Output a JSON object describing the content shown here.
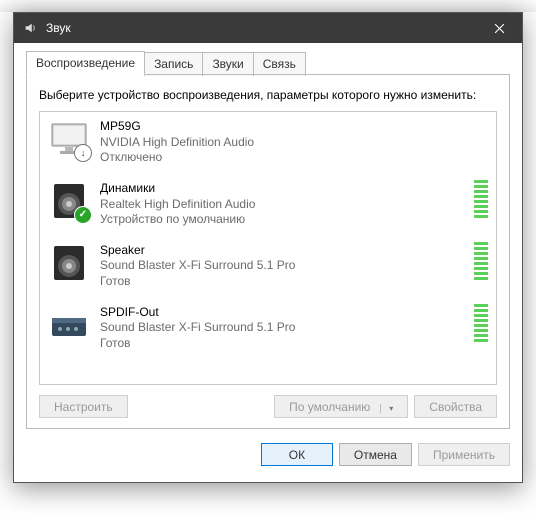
{
  "window": {
    "title": "Звук"
  },
  "tabs": [
    "Воспроизведение",
    "Запись",
    "Звуки",
    "Связь"
  ],
  "activeTab": 0,
  "instruction": "Выберите устройство воспроизведения, параметры которого нужно изменить:",
  "devices": [
    {
      "name": "MP59G",
      "desc": "NVIDIA High Definition Audio",
      "status": "Отключено",
      "icon": "monitor",
      "badge": "down",
      "meter": false
    },
    {
      "name": "Динамики",
      "desc": "Realtek High Definition Audio",
      "status": "Устройство по умолчанию",
      "icon": "speaker-round",
      "badge": "check",
      "meter": true
    },
    {
      "name": "Speaker",
      "desc": "Sound Blaster X-Fi Surround 5.1 Pro",
      "status": "Готов",
      "icon": "speaker-round",
      "badge": null,
      "meter": true
    },
    {
      "name": "SPDIF-Out",
      "desc": "Sound Blaster X-Fi Surround 5.1 Pro",
      "status": "Готов",
      "icon": "box",
      "badge": null,
      "meter": true
    }
  ],
  "panelButtons": {
    "configure": "Настроить",
    "setDefault": "По умолчанию",
    "properties": "Свойства"
  },
  "footer": {
    "ok": "ОК",
    "cancel": "Отмена",
    "apply": "Применить"
  }
}
